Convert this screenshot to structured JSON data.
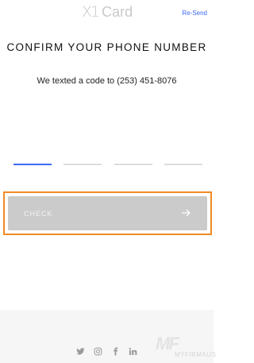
{
  "header": {
    "logo_mark": "X1",
    "logo_word": "Card",
    "resend_label": "Re-Send"
  },
  "main": {
    "title": "CONFIRM YOUR PHONE NUMBER",
    "subtitle": "We texted a code to (253) 451-8076",
    "code_fields": [
      {
        "value": "",
        "active": true
      },
      {
        "value": "",
        "active": false
      },
      {
        "value": "",
        "active": false
      },
      {
        "value": "",
        "active": false
      }
    ],
    "check_label": "CHECK",
    "check_icon": "arrow-right-icon"
  },
  "footer": {
    "social_icons": [
      "twitter-icon",
      "instagram-icon",
      "facebook-icon",
      "linkedin-icon"
    ],
    "watermark_text": "MYFIRMAUS"
  },
  "colors": {
    "accent": "#3b6bf0",
    "highlight": "#f08a24",
    "button_disabled": "#cbcbcb"
  }
}
